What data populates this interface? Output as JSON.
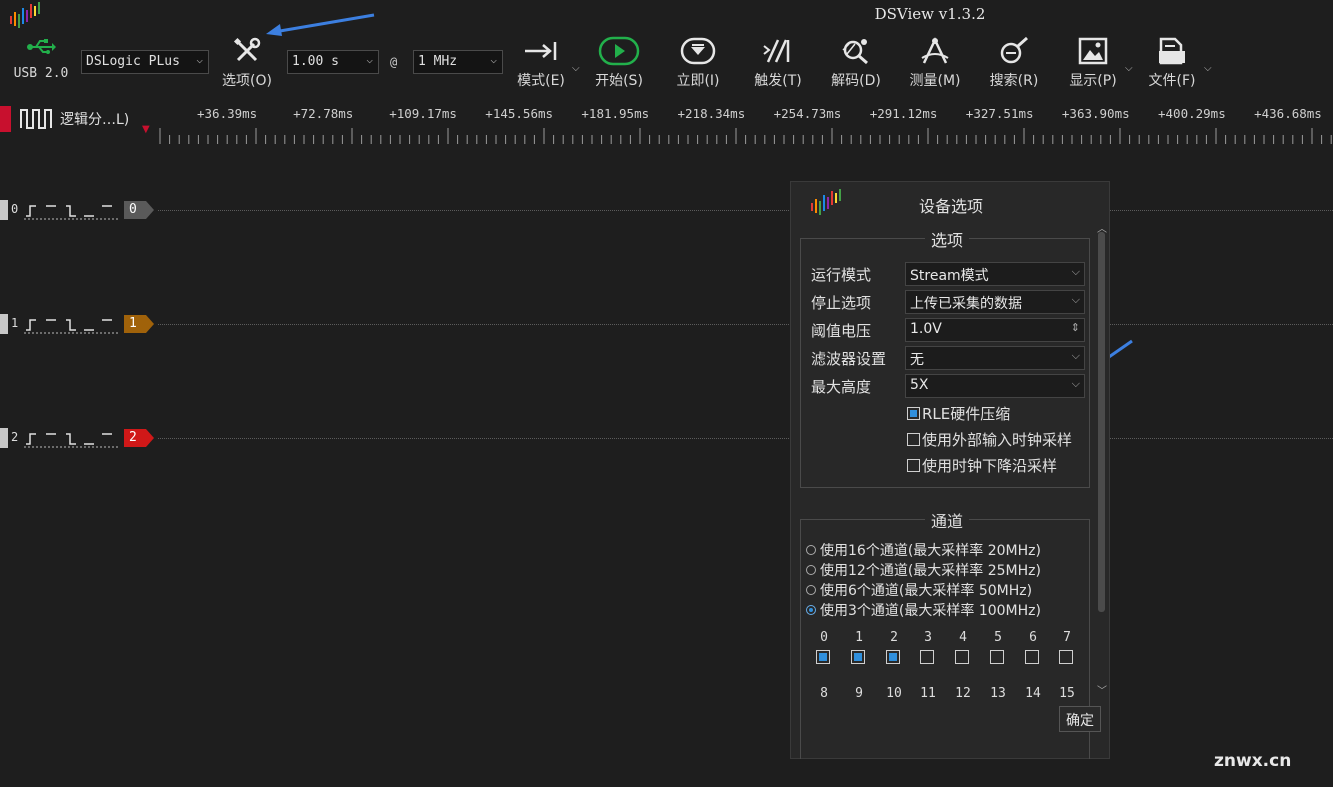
{
  "app": {
    "title": "DSView v1.3.2"
  },
  "toolbar": {
    "usb_label": "USB 2.0",
    "device": "DSLogic PLus",
    "options_label": "选项(O)",
    "duration": "1.00 s",
    "at_sign": "@",
    "samplerate": "1 MHz",
    "mode_label": "模式(E)",
    "start_label": "开始(S)",
    "instant_label": "立即(I)",
    "trigger_label": "触发(T)",
    "decode_label": "解码(D)",
    "measure_label": "测量(M)",
    "search_label": "搜索(R)",
    "display_label": "显示(P)",
    "file_label": "文件(F)"
  },
  "ruler": {
    "group_label": "逻辑分…L)",
    "ticks": [
      "+36.39ms",
      "+72.78ms",
      "+109.17ms",
      "+145.56ms",
      "+181.95ms",
      "+218.34ms",
      "+254.73ms",
      "+291.12ms",
      "+327.51ms",
      "+363.90ms",
      "+400.29ms",
      "+436.68ms"
    ]
  },
  "channels": [
    {
      "num": "0",
      "tag": "0",
      "color": "#5a5a5a"
    },
    {
      "num": "1",
      "tag": "1",
      "color": "#a0620a"
    },
    {
      "num": "2",
      "tag": "2",
      "color": "#d01818"
    }
  ],
  "dialog": {
    "title": "设备选项",
    "options_group": "选项",
    "rows": [
      {
        "label": "运行模式",
        "value": "Stream模式"
      },
      {
        "label": "停止选项",
        "value": "上传已采集的数据"
      },
      {
        "label": "阈值电压",
        "value": "1.0V"
      },
      {
        "label": "滤波器设置",
        "value": "无"
      },
      {
        "label": "最大高度",
        "value": "5X"
      }
    ],
    "checkboxes": [
      {
        "label": "RLE硬件压缩",
        "checked": true
      },
      {
        "label": "使用外部输入时钟采样",
        "checked": false
      },
      {
        "label": "使用时钟下降沿采样",
        "checked": false
      }
    ],
    "channels_group": "通道",
    "radios": [
      {
        "label": "使用16个通道(最大采样率 20MHz)",
        "checked": false
      },
      {
        "label": "使用12个通道(最大采样率 25MHz)",
        "checked": false
      },
      {
        "label": "使用6个通道(最大采样率 50MHz)",
        "checked": false
      },
      {
        "label": "使用3个通道(最大采样率 100MHz)",
        "checked": true
      }
    ],
    "channel_nums_row1": [
      "0",
      "1",
      "2",
      "3",
      "4",
      "5",
      "6",
      "7"
    ],
    "channel_checked_row1": [
      true,
      true,
      true,
      false,
      false,
      false,
      false,
      false
    ],
    "channel_nums_row2": [
      "8",
      "9",
      "10",
      "11",
      "12",
      "13",
      "14",
      "15"
    ],
    "ok_label": "确定"
  },
  "watermark": "znwx.cn",
  "colors": {
    "accent": "#2f8fdc",
    "annotation_arrow": "#3c7fe0",
    "start_green": "#22b04b"
  }
}
